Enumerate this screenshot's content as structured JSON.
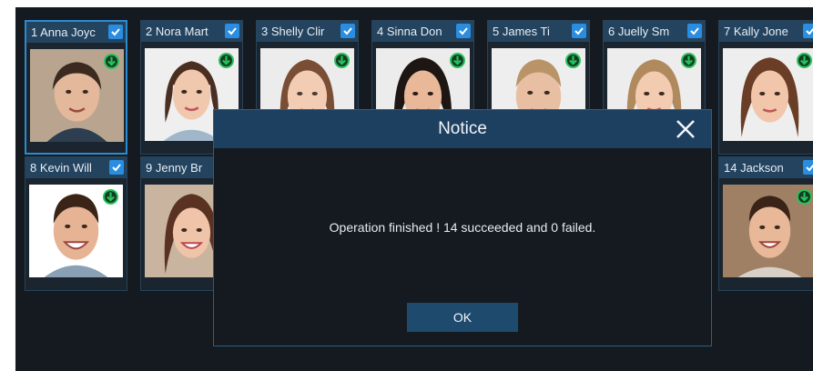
{
  "faces": [
    {
      "label": "1 Anna Joyc",
      "selected": true
    },
    {
      "label": "2 Nora Mart"
    },
    {
      "label": "3 Shelly Clir"
    },
    {
      "label": "4 Sinna Don"
    },
    {
      "label": "5 James Ti"
    },
    {
      "label": "6 Juelly Sm"
    },
    {
      "label": "7 Kally Jone"
    },
    {
      "label": "8 Kevin Will"
    },
    {
      "label": "9 Jenny Br"
    },
    {
      "label": "14 Jackson"
    }
  ],
  "dialog": {
    "title": "Notice",
    "message": "Operation finished ! 14 succeeded and 0 failed.",
    "ok_label": "OK"
  },
  "colors": {
    "background": "#141a1f",
    "card_header": "#24435e",
    "dialog_header": "#1e4060",
    "accent_blue": "#2a8de0",
    "success_green": "#29c25a"
  },
  "icons": {
    "check": "checkbox-checked-icon",
    "download": "download-icon",
    "close": "close-icon"
  }
}
